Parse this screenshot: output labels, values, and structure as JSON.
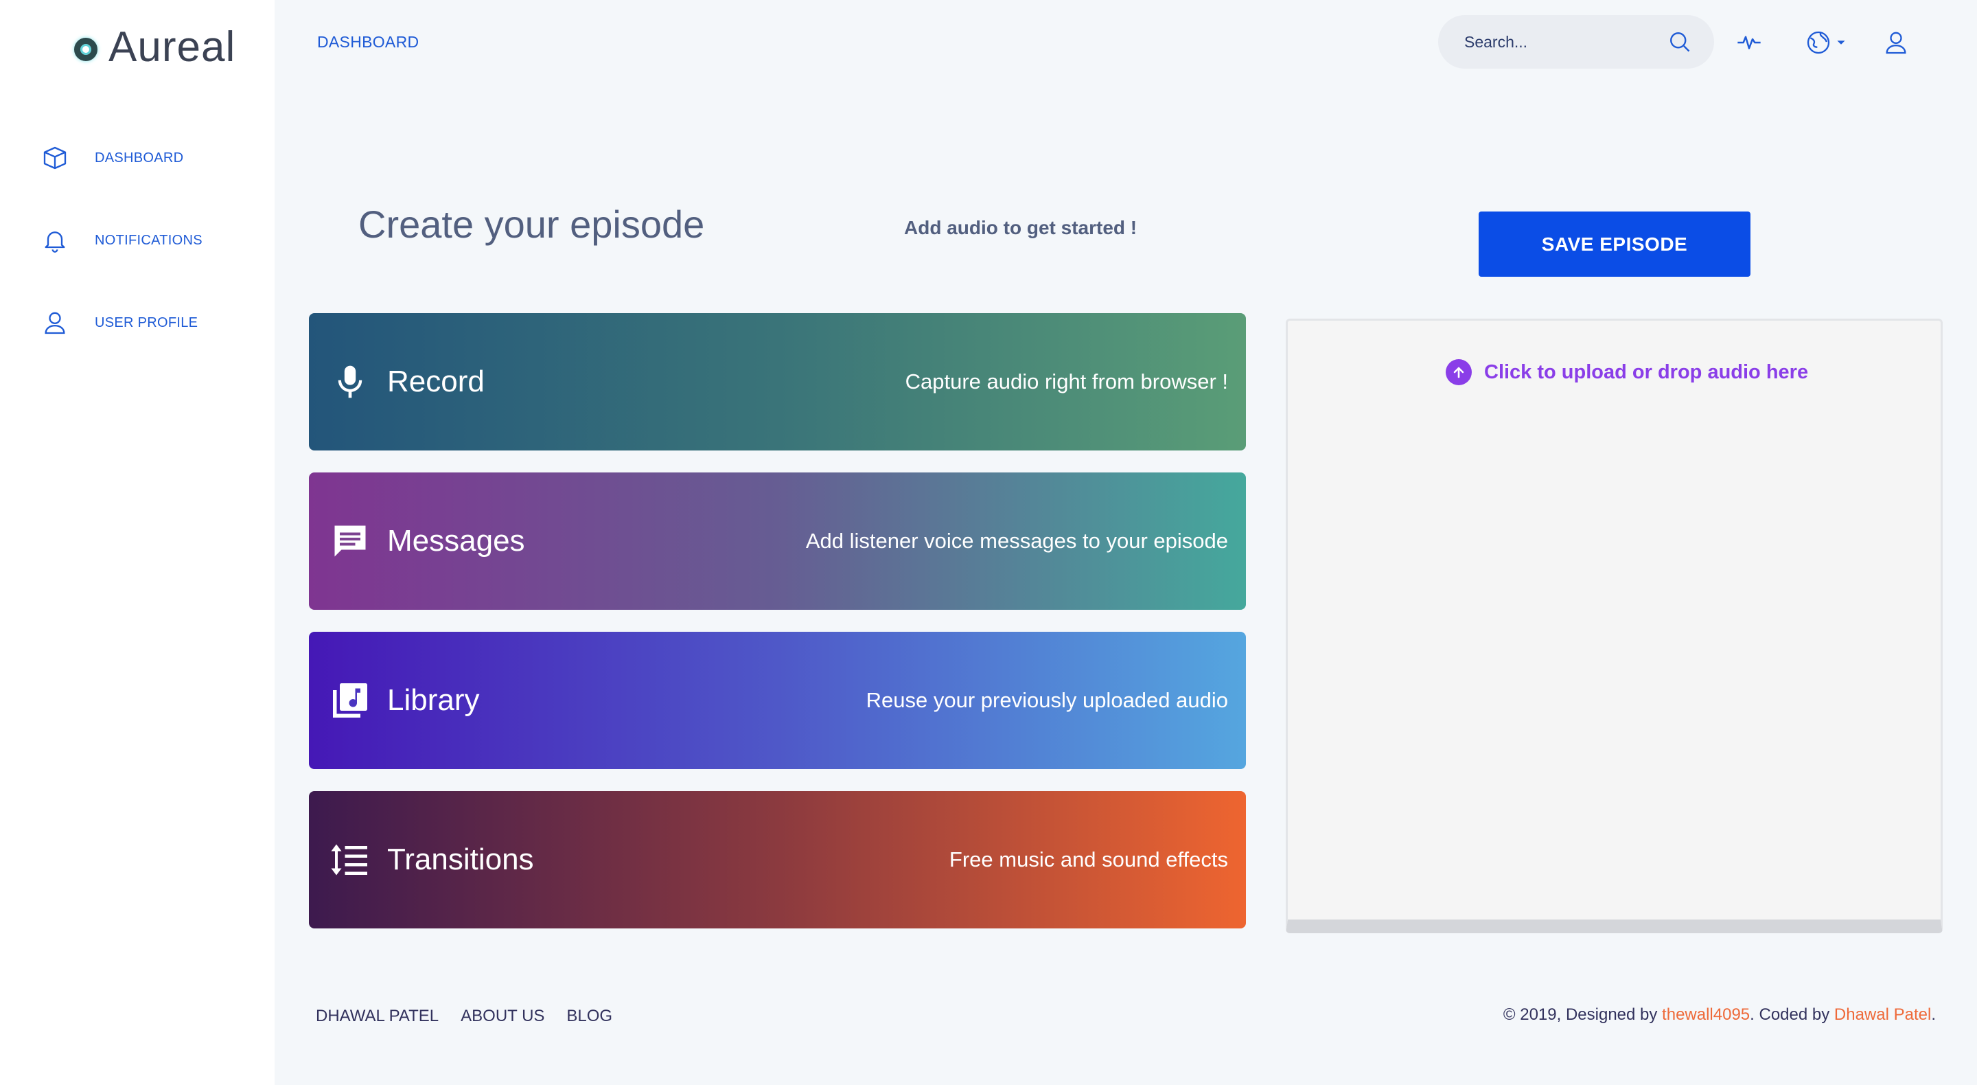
{
  "brand": {
    "name": "Aureal"
  },
  "sidebar": {
    "items": [
      {
        "label": "DASHBOARD",
        "icon": "cube-icon"
      },
      {
        "label": "NOTIFICATIONS",
        "icon": "bell-icon"
      },
      {
        "label": "USER PROFILE",
        "icon": "user-icon"
      }
    ]
  },
  "topbar": {
    "breadcrumb": "DASHBOARD",
    "search_placeholder": "Search...",
    "icons": [
      "search-icon",
      "activity-icon",
      "globe-icon",
      "caret-down-icon",
      "user-icon"
    ]
  },
  "main": {
    "title": "Create your episode",
    "subtitle": "Add audio to get started !",
    "save_label": "SAVE EPISODE",
    "cards": [
      {
        "title": "Record",
        "desc": "Capture audio right from browser !",
        "icon": "microphone-icon"
      },
      {
        "title": "Messages",
        "desc": "Add listener voice messages to your episode",
        "icon": "message-icon"
      },
      {
        "title": "Library",
        "desc": "Reuse your previously uploaded audio",
        "icon": "music-library-icon"
      },
      {
        "title": "Transitions",
        "desc": "Free music and sound effects",
        "icon": "transitions-icon"
      }
    ]
  },
  "upload": {
    "label": "Click to upload or drop audio here",
    "icon": "upload-arrow-icon"
  },
  "footer": {
    "links": [
      "DHAWAL PATEL",
      "ABOUT US",
      "BLOG"
    ],
    "copyright_prefix": "© 2019, Designed by ",
    "designer": "thewall4095",
    "copyright_mid": ". Coded by ",
    "coder": "Dhawal Patel",
    "copyright_suffix": "."
  },
  "colors": {
    "primary": "#0b4de6",
    "link_blue": "#1f5bd6",
    "upload_purple": "#8a3ee8",
    "footer_accent": "#ee6a3a"
  }
}
